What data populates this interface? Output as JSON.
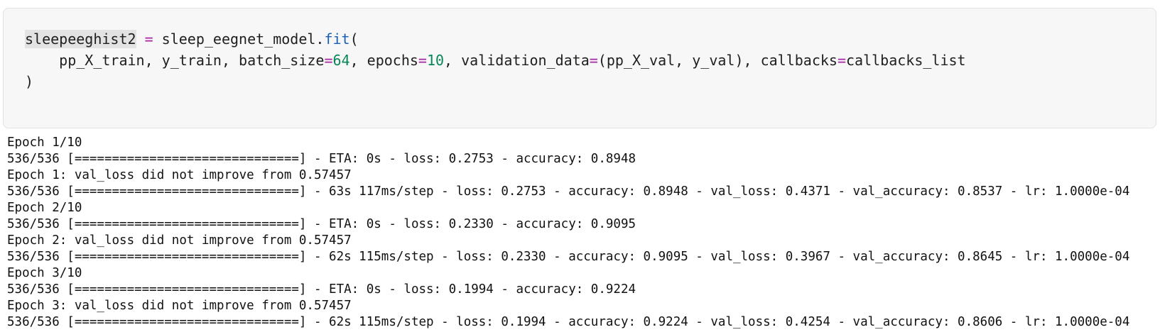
{
  "code": {
    "lines": [
      [
        {
          "t": "sleepeeghist2",
          "c": "tok-var-hl"
        },
        {
          "t": " ",
          "c": "tok-plain"
        },
        {
          "t": "=",
          "c": "tok-op"
        },
        {
          "t": " sleep_eegnet_model.",
          "c": "tok-plain"
        },
        {
          "t": "fit",
          "c": "tok-method"
        },
        {
          "t": "(",
          "c": "tok-plain"
        }
      ],
      [
        {
          "t": "    pp_X_train, y_train, batch_size",
          "c": "tok-plain"
        },
        {
          "t": "=",
          "c": "tok-op"
        },
        {
          "t": "64",
          "c": "tok-num"
        },
        {
          "t": ", epochs",
          "c": "tok-plain"
        },
        {
          "t": "=",
          "c": "tok-op"
        },
        {
          "t": "10",
          "c": "tok-num"
        },
        {
          "t": ", validation_data",
          "c": "tok-plain"
        },
        {
          "t": "=",
          "c": "tok-op"
        },
        {
          "t": "(pp_X_val, y_val), callbacks",
          "c": "tok-plain"
        },
        {
          "t": "=",
          "c": "tok-op"
        },
        {
          "t": "callbacks_list",
          "c": "tok-plain"
        }
      ],
      [
        {
          "t": ")",
          "c": "tok-plain"
        }
      ]
    ]
  },
  "output": {
    "lines": [
      "Epoch 1/10",
      "536/536 [==============================] - ETA: 0s - loss: 0.2753 - accuracy: 0.8948",
      "Epoch 1: val_loss did not improve from 0.57457",
      "536/536 [==============================] - 63s 117ms/step - loss: 0.2753 - accuracy: 0.8948 - val_loss: 0.4371 - val_accuracy: 0.8537 - lr: 1.0000e-04",
      "Epoch 2/10",
      "536/536 [==============================] - ETA: 0s - loss: 0.2330 - accuracy: 0.9095",
      "Epoch 2: val_loss did not improve from 0.57457",
      "536/536 [==============================] - 62s 115ms/step - loss: 0.2330 - accuracy: 0.9095 - val_loss: 0.3967 - val_accuracy: 0.8645 - lr: 1.0000e-04",
      "Epoch 3/10",
      "536/536 [==============================] - ETA: 0s - loss: 0.1994 - accuracy: 0.9224",
      "Epoch 3: val_loss did not improve from 0.57457",
      "536/536 [==============================] - 62s 115ms/step - loss: 0.1994 - accuracy: 0.9224 - val_loss: 0.4254 - val_accuracy: 0.8606 - lr: 1.0000e-04"
    ]
  }
}
